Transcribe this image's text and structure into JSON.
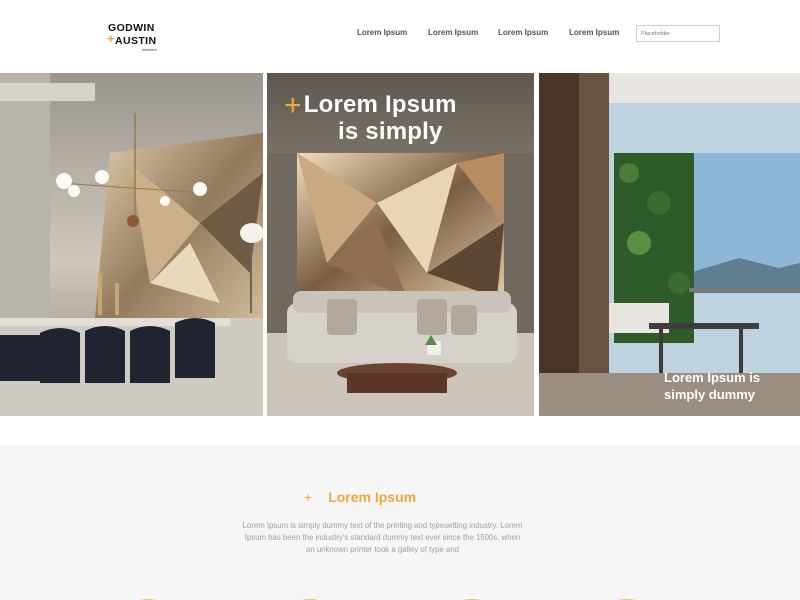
{
  "header": {
    "logo": {
      "line1": "GODWIN",
      "plus": "+",
      "line2": "AUSTIN",
      "tag": "Interiors"
    },
    "nav": [
      "Lorem Ipsum",
      "Lorem Ipsum",
      "Lorem Ipsum",
      "Lorem Ipsum"
    ],
    "search": {
      "placeholder": "Placeholder"
    }
  },
  "hero": {
    "title": {
      "plus": "+",
      "line1": "Lorem Ipsum",
      "line2": "is simply"
    },
    "caption": {
      "line1": "Lorem Ipsum is",
      "line2": "simply dummy"
    },
    "panel_names": [
      "dining-room-image",
      "living-room-image",
      "balcony-image"
    ]
  },
  "section": {
    "plus": "+",
    "title": "Lorem Ipsum",
    "text": "Lorem Ipsum is simply dummy text of the printing and typesetting industry. Lorem Ipsum has been the industry's standard dummy text ever since the 1500s, when an unknown printer took a galley of type and"
  },
  "colors": {
    "accent": "#f2a93b",
    "text_gray": "#a0a0a0",
    "section_bg": "#f6f6f6"
  }
}
